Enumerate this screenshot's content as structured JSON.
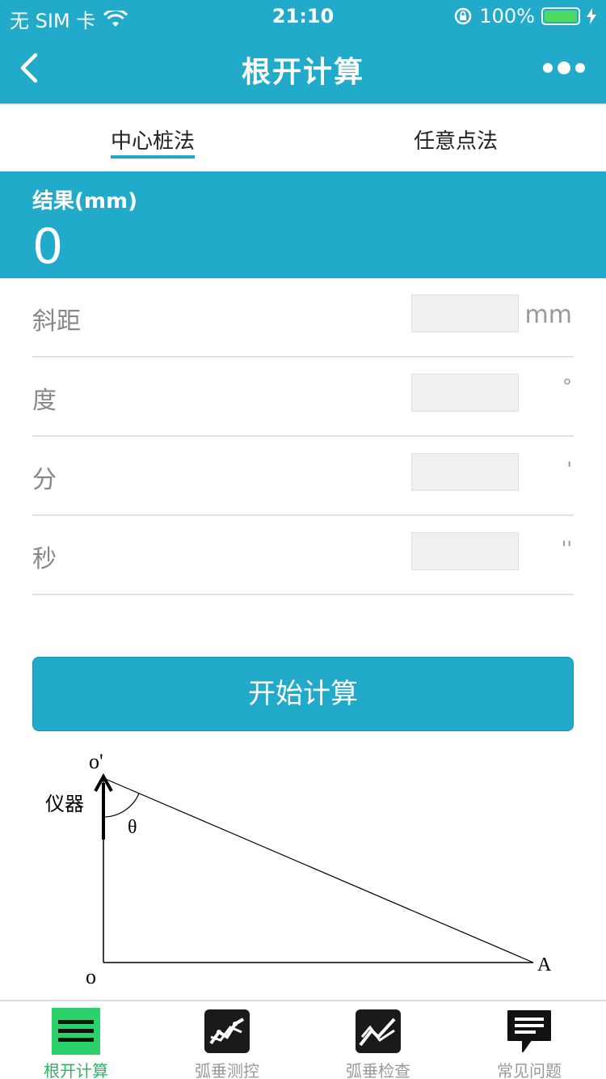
{
  "status": {
    "carrier": "无 SIM 卡",
    "time": "21:10",
    "battery": "100%"
  },
  "nav": {
    "title": "根开计算"
  },
  "tabs": [
    {
      "label": "中心桩法",
      "active": true
    },
    {
      "label": "任意点法",
      "active": false
    }
  ],
  "result": {
    "label": "结果(mm)",
    "value": "0"
  },
  "form": {
    "rows": [
      {
        "label": "斜距",
        "unit": "mm",
        "value": ""
      },
      {
        "label": "度",
        "unit": "°",
        "value": ""
      },
      {
        "label": "分",
        "unit": "'",
        "value": ""
      },
      {
        "label": "秒",
        "unit": "''",
        "value": ""
      }
    ]
  },
  "button": {
    "label": "开始计算"
  },
  "diagram": {
    "top_label": "o'",
    "instrument_label": "仪器",
    "angle_label": "θ",
    "origin_label": "o",
    "point_label": "A"
  },
  "bottom_nav": [
    {
      "label": "根开计算",
      "icon": "menu-icon",
      "active": true
    },
    {
      "label": "弧垂测控",
      "icon": "chart-icon",
      "active": false
    },
    {
      "label": "弧垂检查",
      "icon": "chart-check-icon",
      "active": false
    },
    {
      "label": "常见问题",
      "icon": "chat-icon",
      "active": false
    }
  ],
  "colors": {
    "primary": "#21aac9",
    "active_tab": "#2bb560"
  }
}
